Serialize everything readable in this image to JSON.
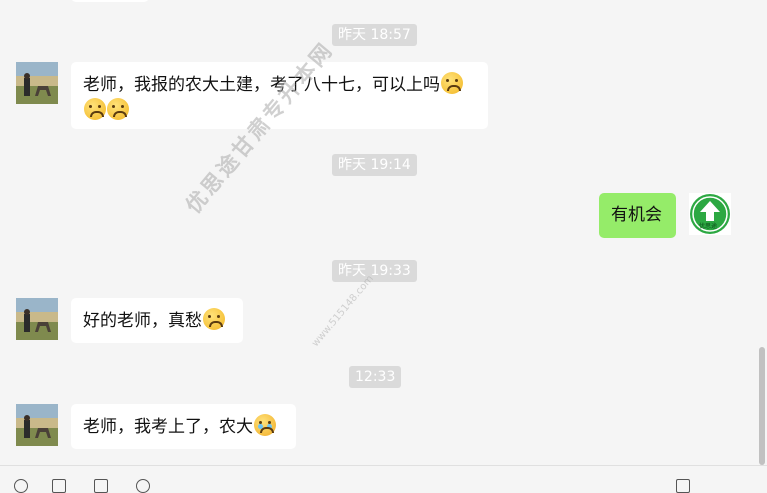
{
  "colors": {
    "background": "#f5f5f5",
    "timestamp_bg": "#dadada",
    "incoming_bubble": "#ffffff",
    "outgoing_bubble": "#95ec69",
    "brand_avatar": "#2ca842"
  },
  "messages": [
    {
      "type": "timestamp",
      "text": "昨天 18:57"
    },
    {
      "type": "incoming",
      "text": "老师，我报的农大土建，考了八十七，可以上吗",
      "emoji": [
        "grimace-emoji",
        "grimace-emoji",
        "grimace-emoji"
      ]
    },
    {
      "type": "timestamp",
      "text": "昨天 19:14"
    },
    {
      "type": "outgoing",
      "text": "有机会"
    },
    {
      "type": "timestamp",
      "text": "昨天 19:33"
    },
    {
      "type": "incoming",
      "text": "好的老师，真愁",
      "emoji": [
        "grimace-emoji"
      ]
    },
    {
      "type": "timestamp",
      "text": "12:33"
    },
    {
      "type": "incoming",
      "text": "老师，我考上了，农大",
      "emoji": [
        "crying-emoji"
      ]
    }
  ],
  "watermark": {
    "title": "优思途甘肃专升本网",
    "url": "www.515148.com"
  },
  "brand_avatar_label": "优思途"
}
